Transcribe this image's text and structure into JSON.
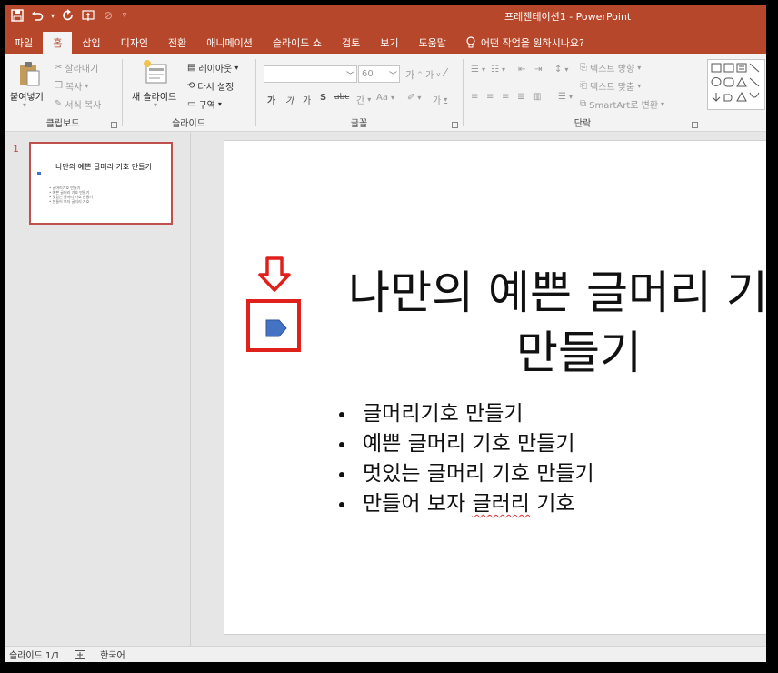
{
  "window": {
    "title": "프레젠테이션1  -  PowerPoint"
  },
  "quick_access": {
    "icons": [
      "save-icon",
      "undo-icon",
      "redo-icon",
      "touch-mode-icon",
      "customize-icon"
    ]
  },
  "tabs": [
    {
      "label": "파일",
      "active": false
    },
    {
      "label": "홈",
      "active": true
    },
    {
      "label": "삽입",
      "active": false
    },
    {
      "label": "디자인",
      "active": false
    },
    {
      "label": "전환",
      "active": false
    },
    {
      "label": "애니메이션",
      "active": false
    },
    {
      "label": "슬라이드 쇼",
      "active": false
    },
    {
      "label": "검토",
      "active": false
    },
    {
      "label": "보기",
      "active": false
    },
    {
      "label": "도움말",
      "active": false
    }
  ],
  "tell_me": "어떤 작업을 원하시나요?",
  "ribbon": {
    "clipboard": {
      "label": "클립보드",
      "paste": "붙여넣기",
      "cut": "잘라내기",
      "copy": "복사",
      "format_painter": "서식 복사"
    },
    "slides": {
      "label": "슬라이드",
      "new_slide": "새 슬라이드",
      "layout": "레이아웃",
      "reset": "다시 설정",
      "section": "구역"
    },
    "font": {
      "label": "글꼴",
      "font_size": "60",
      "font_name": ""
    },
    "paragraph": {
      "label": "단락",
      "text_direction": "텍스트 방향",
      "align_text": "텍스트 맞춤",
      "smartart": "SmartArt로 변환"
    }
  },
  "slide_thumb": {
    "number": "1",
    "title": "나만의 예쁜 글머리 기호 만들기",
    "bullets": [
      "글머리기호 만들기",
      "예쁜 글머리 기호 만들기",
      "멋있는 글머리 기호 만들기",
      "만들어 보자 글러리 기호"
    ]
  },
  "slide": {
    "title_line1": "나만의 예쁜 글머리 기호",
    "title_line2": "만들기",
    "bullets": [
      "글머리기호 만들기",
      "예쁜 글머리 기호 만들기",
      "멋있는 글머리 기호 만들기",
      "만들어 보자 "
    ],
    "last_bullet_misspelled": "글러리",
    "last_bullet_tail": " 기호"
  },
  "colors": {
    "accent": "#b7472a",
    "highlight": "#e0201b",
    "marker": "#4472c4"
  },
  "statusbar": {
    "slide_counter": "슬라이드 1/1",
    "language": "한국어"
  }
}
